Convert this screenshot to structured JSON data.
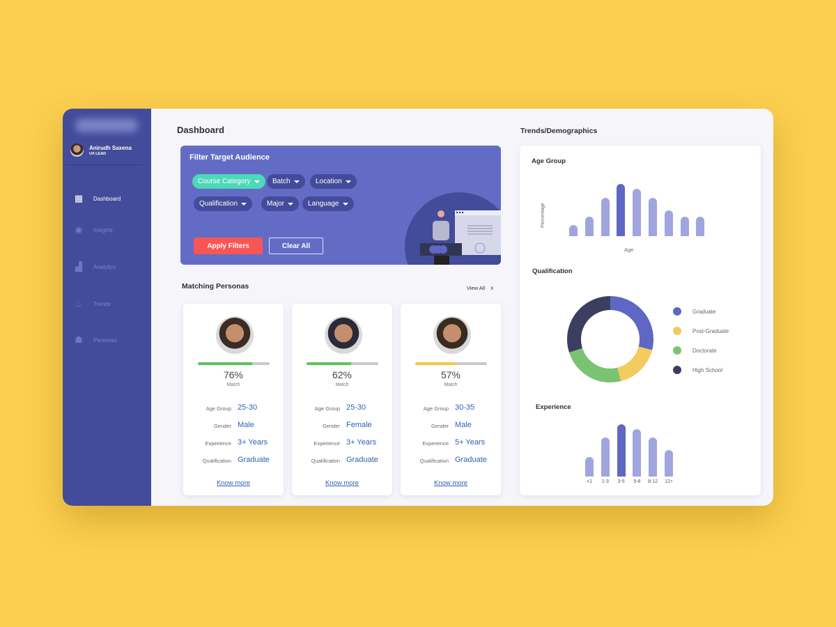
{
  "user": {
    "name": "Anirudh Saxena",
    "role": "UX LEAD"
  },
  "sidebar": {
    "items": [
      {
        "label": "Dashboard",
        "icon": "dashboard-icon",
        "active": true
      },
      {
        "label": "Insights",
        "icon": "insights-icon",
        "active": false
      },
      {
        "label": "Analytics",
        "icon": "analytics-icon",
        "active": false
      },
      {
        "label": "Trends",
        "icon": "trends-icon",
        "active": false
      },
      {
        "label": "Personas",
        "icon": "personas-icon",
        "active": false
      }
    ]
  },
  "main": {
    "title": "Dashboard",
    "filter": {
      "title": "Filter Target Audience",
      "chips": [
        "Course Category",
        "Batch",
        "Location",
        "Qualification",
        "Major",
        "Language"
      ],
      "selected": "Course Category",
      "apply_label": "Apply Filters",
      "clear_label": "Clear All"
    },
    "personas": {
      "title": "Matching Personas",
      "view_all": "View All",
      "cards": [
        {
          "match": "76%",
          "match_value": 76,
          "match_color": "#5cc45c",
          "match_label": "Match",
          "fields": [
            [
              "Age Group",
              "25-30"
            ],
            [
              "Gender",
              "Male"
            ],
            [
              "Experience",
              "3+ Years"
            ],
            [
              "Qualification",
              "Graduate"
            ]
          ],
          "link": "Know more"
        },
        {
          "match": "62%",
          "match_value": 62,
          "match_color": "#5cc45c",
          "match_label": "Match",
          "fields": [
            [
              "Age Group",
              "25-30"
            ],
            [
              "Gender",
              "Female"
            ],
            [
              "Experience",
              "3+ Years"
            ],
            [
              "Qualification",
              "Graduate"
            ]
          ],
          "link": "Know more"
        },
        {
          "match": "57%",
          "match_value": 57,
          "match_color": "#f5c542",
          "match_label": "Match",
          "fields": [
            [
              "Age Group",
              "30-35"
            ],
            [
              "Gender",
              "Male"
            ],
            [
              "Experience",
              "5+ Years"
            ],
            [
              "Qualification",
              "Graduate"
            ]
          ],
          "link": "Know more"
        }
      ]
    }
  },
  "trends": {
    "title": "Trends/Demographics"
  },
  "chart_data": [
    {
      "type": "bar",
      "title": "Age Group",
      "xlabel": "Age",
      "ylabel": "Percentage",
      "values": [
        16,
        28,
        55,
        75,
        68,
        55,
        37,
        28,
        28
      ],
      "highlight_index": 3,
      "grid": false
    },
    {
      "type": "pie",
      "title": "Qualification",
      "donut": true,
      "legend": "right",
      "slices": [
        {
          "name": "Graduate",
          "value": 29,
          "color": "#5f67c4"
        },
        {
          "name": "Post-Graduate",
          "value": 17,
          "color": "#f3cb5e"
        },
        {
          "name": "Doctorate",
          "value": 24,
          "color": "#79c472"
        },
        {
          "name": "High School",
          "value": 30,
          "color": "#3d3e5f"
        }
      ]
    },
    {
      "type": "bar",
      "title": "Experience",
      "categories": [
        "<1",
        "1-3",
        "3-5",
        "5-8",
        "8-12",
        "12+"
      ],
      "values": [
        28,
        56,
        75,
        68,
        56,
        38
      ],
      "highlight_index": 2,
      "grid": false
    }
  ]
}
